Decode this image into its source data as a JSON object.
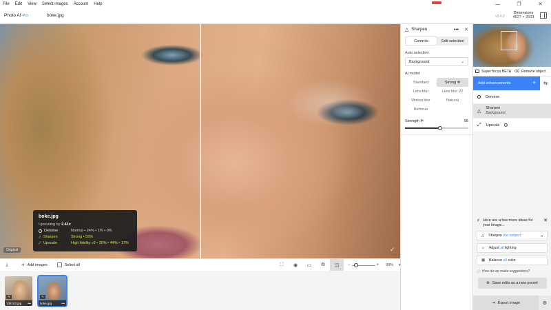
{
  "menu": [
    "File",
    "Edit",
    "View",
    "Select images",
    "Account",
    "Help"
  ],
  "window_controls": {
    "minimize": "—",
    "maximize": "❐",
    "close": "✕"
  },
  "app": {
    "name": "Photo AI",
    "edition": "Pro",
    "file": "boke.jpg",
    "version": "v3.4.2"
  },
  "dimensions": {
    "label": "Dimensions",
    "value": "4627 × 2603"
  },
  "viewer": {
    "original_tag": "Original",
    "info": {
      "title": "boke.jpg",
      "upscaling_label": "Upscaling by",
      "upscaling_value": "2.41x",
      "rows": [
        {
          "label": "Denoise",
          "value": "Normal • 24% • 1% • 0%"
        },
        {
          "label": "Sharpen",
          "value": "Strong • 55%"
        },
        {
          "label": "Upscale",
          "value": "High fidelity v2 • 20% • 44% • 17%"
        }
      ]
    }
  },
  "bottombar": {
    "add_images": "Add images",
    "select_all": "Select all",
    "zoom": "99%"
  },
  "filmstrip": [
    {
      "name": "138163.jpg",
      "selected": false
    },
    {
      "name": "boke.jpg",
      "selected": true
    }
  ],
  "sharpen": {
    "title": "Sharpen",
    "tabs": [
      "Controls",
      "Edit selection"
    ],
    "auto_selection_label": "Auto selection",
    "auto_selection_value": "Background",
    "ai_model_label": "AI model",
    "models": [
      "Standard",
      "Strong",
      "Lens blur",
      "Lens blur V2",
      "Motion blur",
      "Natural",
      "Refocus"
    ],
    "selected_model": "Strong",
    "strength_label": "Strength",
    "strength_value": "55",
    "strength_fraction": 0.55
  },
  "rightbar": {
    "tools": [
      "Super focus BETA",
      "Remove object"
    ],
    "add_enhancements": "Add enhancements",
    "enhancements": [
      {
        "label": "Denoise",
        "sub": ""
      },
      {
        "label": "Sharpen",
        "sub": "Background"
      },
      {
        "label": "Upscale",
        "sub": ""
      }
    ],
    "ideas_text": "Here are a few more ideas for your image...",
    "suggestions": [
      {
        "pre": "Sharpen",
        "accent": "the subject",
        "post": ""
      },
      {
        "pre": "Adjust",
        "accent": "all",
        "post": "lighting"
      },
      {
        "pre": "Balance",
        "accent": "all",
        "post": "color"
      }
    ],
    "how_text": "How do we make suggestions?",
    "save_preset": "Save edits as a new preset",
    "export": "Export image"
  }
}
